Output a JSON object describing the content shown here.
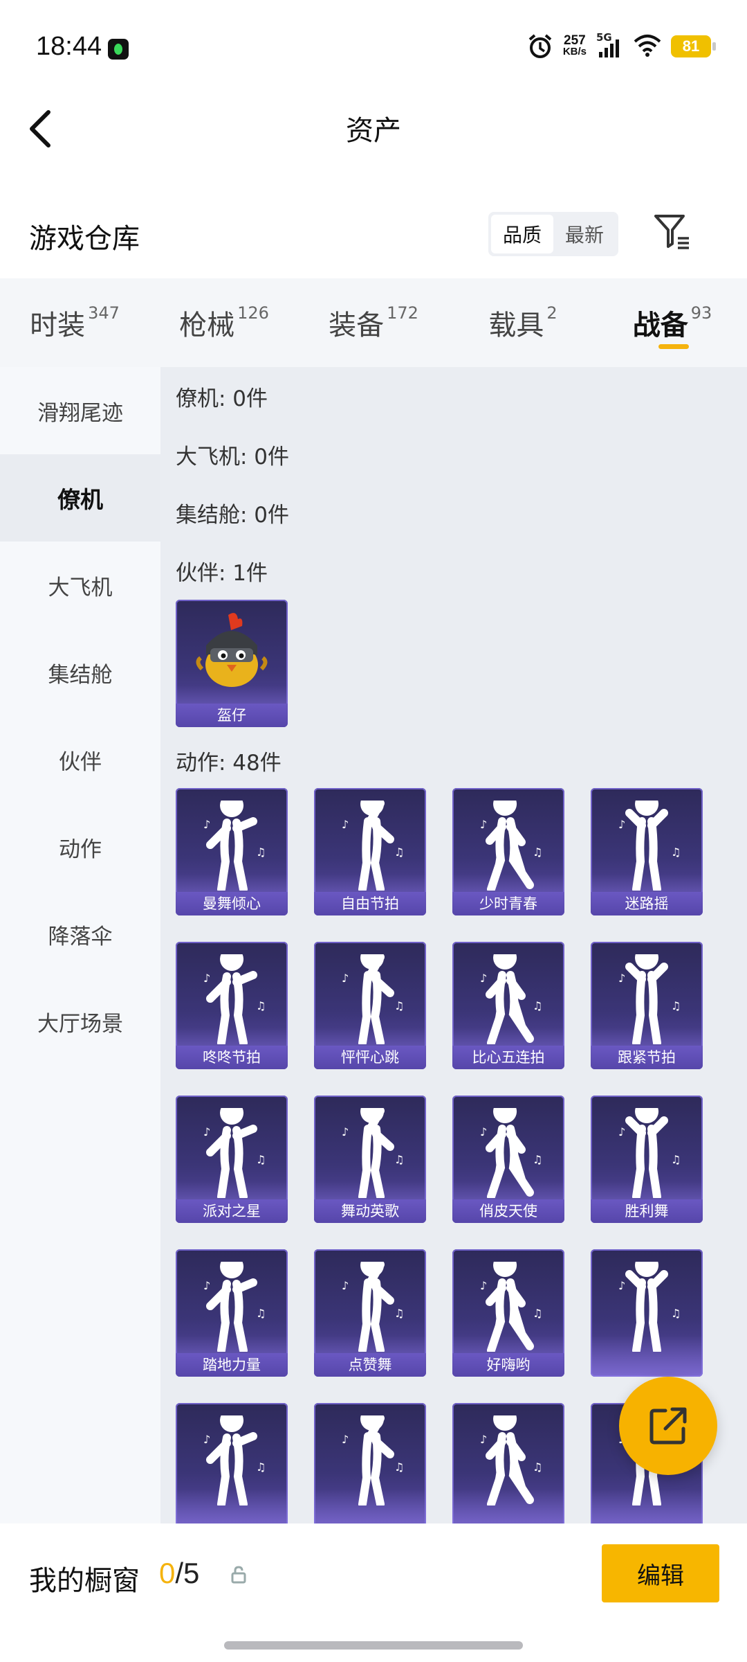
{
  "status": {
    "time": "18:44",
    "net_speed_value": "257",
    "net_speed_unit": "KB/s",
    "network": "5G",
    "battery": "81"
  },
  "header": {
    "title": "资产",
    "warehouse_title": "游戏仓库",
    "sort_options": [
      "品质",
      "最新"
    ],
    "active_sort": "品质"
  },
  "tabs": [
    {
      "label": "时装",
      "count": "347"
    },
    {
      "label": "枪械",
      "count": "126"
    },
    {
      "label": "装备",
      "count": "172"
    },
    {
      "label": "载具",
      "count": "2"
    },
    {
      "label": "战备",
      "count": "93",
      "active": true
    }
  ],
  "sidebar": {
    "items": [
      "滑翔尾迹",
      "僚机",
      "大飞机",
      "集结舱",
      "伙伴",
      "动作",
      "降落伞",
      "大厅场景"
    ],
    "active": "僚机"
  },
  "sections": {
    "wingman": "僚机: 0件",
    "plane": "大飞机: 0件",
    "pod": "集结舱: 0件",
    "partner": "伙伴: 1件",
    "emote": "动作: 48件"
  },
  "partner_items": [
    "盔仔"
  ],
  "emote_items": [
    "曼舞倾心",
    "自由节拍",
    "少时青春",
    "迷路摇",
    "咚咚节拍",
    "怦怦心跳",
    "比心五连拍",
    "跟紧节拍",
    "派对之星",
    "舞动英歌",
    "俏皮天使",
    "胜利舞",
    "踏地力量",
    "点赞舞",
    "好嗨哟",
    "",
    "",
    "",
    "",
    ""
  ],
  "bottom": {
    "window_title": "我的橱窗",
    "window_used": "0",
    "window_total": "/5",
    "edit_label": "编辑"
  },
  "colors": {
    "accent": "#f7b600",
    "card_bg": "#3b3577",
    "card_label": "#5e4db5"
  }
}
